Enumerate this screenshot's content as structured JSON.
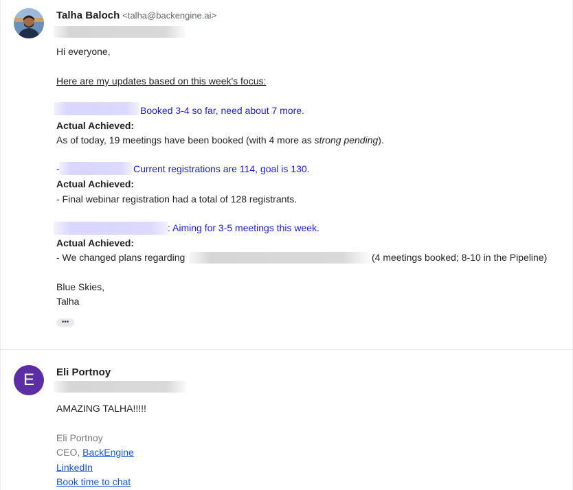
{
  "message1": {
    "sender_name": "Talha Baloch",
    "sender_email": "<talha@backengine.ai>",
    "greeting": "Hi everyone,",
    "intro": "Here are my updates based on this week's focus:",
    "item1_goal": "Booked 3-4 so far, need about 7 more.",
    "item1_actual_label": "Actual Achieved:",
    "item1_actual_pre": "As of today, 19 meetings have been booked (with 4 more as ",
    "item1_actual_em": "strong pending",
    "item1_actual_post": ").",
    "item2_prefix": "-",
    "item2_goal": "Current registrations are 114, goal is 130.",
    "item2_actual_label": "Actual Achieved:",
    "item2_actual": "- Final webinar registration had a total of 128 registrants.",
    "item3_goal": ": Aiming for 3-5 meetings this week.",
    "item3_actual_label": "Actual Achieved:",
    "item3_actual_pre": "- We changed plans regarding",
    "item3_actual_post": "(4 meetings booked; 8-10 in the Pipeline)",
    "signoff": "Blue Skies,",
    "signature": "Talha",
    "more_label": "•••"
  },
  "message2": {
    "sender_name": "Eli Portnoy",
    "avatar_letter": "E",
    "avatar_color": "#5b2ea6",
    "body": "AMAZING TALHA!!!!!",
    "sig_name": "Eli Portnoy",
    "sig_title_prefix": "CEO, ",
    "sig_company_link": "BackEngine",
    "linkedin_link": "LinkedIn",
    "book_link": "Book time to chat"
  }
}
